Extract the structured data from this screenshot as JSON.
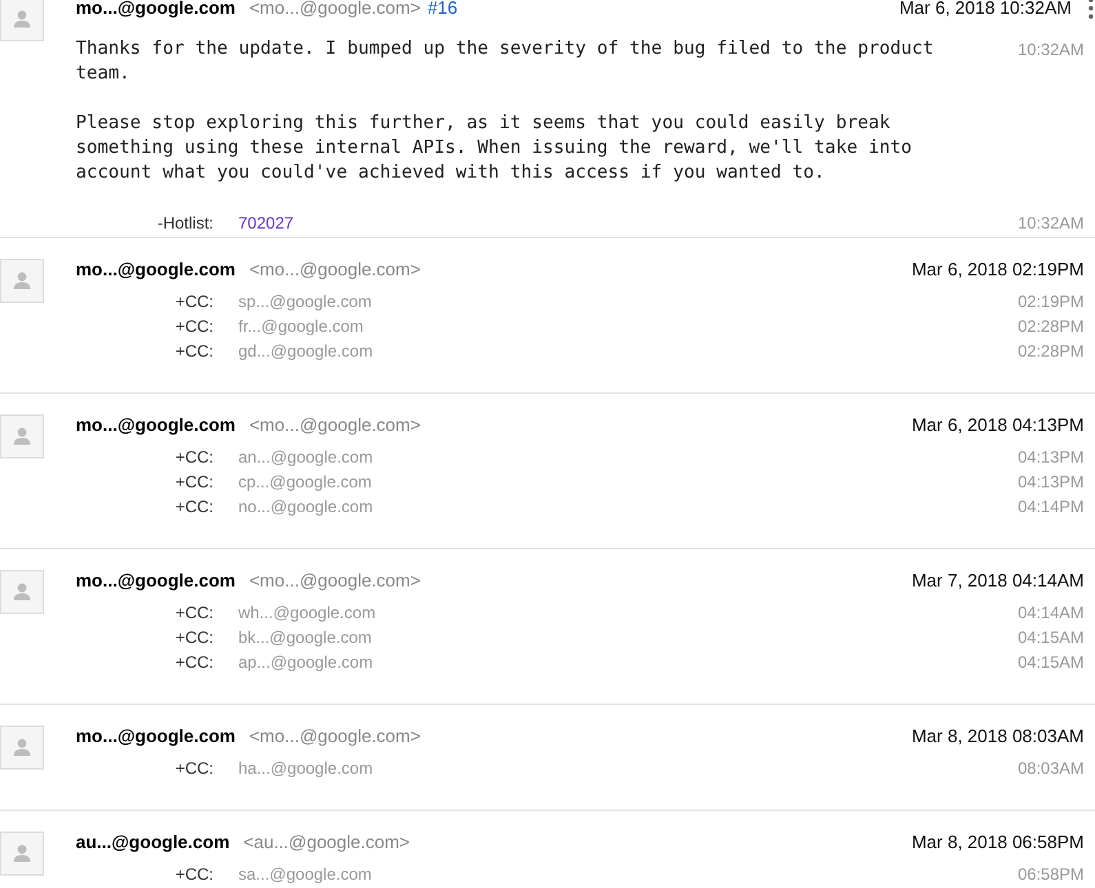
{
  "comments": [
    {
      "author": "mo...@google.com",
      "email": "<mo...@google.com>",
      "number": "#16",
      "date": "Mar 6, 2018 10:32AM",
      "menu": true,
      "body": [
        "Thanks for the update. I bumped up the severity of the bug filed to the product team.",
        "Please stop exploring this further, as it seems that you could easily break something using these internal APIs. When issuing the reward, we'll take into account what you could've achieved with this access if you wanted to."
      ],
      "body_time": "10:32AM",
      "changes": [
        {
          "label": "-Hotlist:",
          "value": "702027",
          "kind": "link",
          "time": "10:32AM"
        }
      ]
    },
    {
      "author": "mo...@google.com",
      "email": "<mo...@google.com>",
      "date": "Mar 6, 2018 02:19PM",
      "changes": [
        {
          "label": "+CC:",
          "value": "sp...@google.com",
          "kind": "email",
          "time": "02:19PM"
        },
        {
          "label": "+CC:",
          "value": "fr...@google.com",
          "kind": "email",
          "time": "02:28PM"
        },
        {
          "label": "+CC:",
          "value": "gd...@google.com",
          "kind": "email",
          "time": "02:28PM"
        }
      ]
    },
    {
      "author": "mo...@google.com",
      "email": "<mo...@google.com>",
      "date": "Mar 6, 2018 04:13PM",
      "changes": [
        {
          "label": "+CC:",
          "value": "an...@google.com",
          "kind": "email",
          "time": "04:13PM"
        },
        {
          "label": "+CC:",
          "value": "cp...@google.com",
          "kind": "email",
          "time": "04:13PM"
        },
        {
          "label": "+CC:",
          "value": "no...@google.com",
          "kind": "email",
          "time": "04:14PM"
        }
      ]
    },
    {
      "author": "mo...@google.com",
      "email": "<mo...@google.com>",
      "date": "Mar 7, 2018 04:14AM",
      "changes": [
        {
          "label": "+CC:",
          "value": "wh...@google.com",
          "kind": "email",
          "time": "04:14AM"
        },
        {
          "label": "+CC:",
          "value": "bk...@google.com",
          "kind": "email",
          "time": "04:15AM"
        },
        {
          "label": "+CC:",
          "value": "ap...@google.com",
          "kind": "email",
          "time": "04:15AM"
        }
      ]
    },
    {
      "author": "mo...@google.com",
      "email": "<mo...@google.com>",
      "date": "Mar 8, 2018 08:03AM",
      "changes": [
        {
          "label": "+CC:",
          "value": "ha...@google.com",
          "kind": "email",
          "time": "08:03AM"
        }
      ]
    },
    {
      "author": "au...@google.com",
      "email": "<au...@google.com>",
      "date": "Mar 8, 2018 06:58PM",
      "changes": [
        {
          "label": "+CC:",
          "value": "sa...@google.com",
          "kind": "email",
          "time": "06:58PM"
        }
      ]
    }
  ]
}
